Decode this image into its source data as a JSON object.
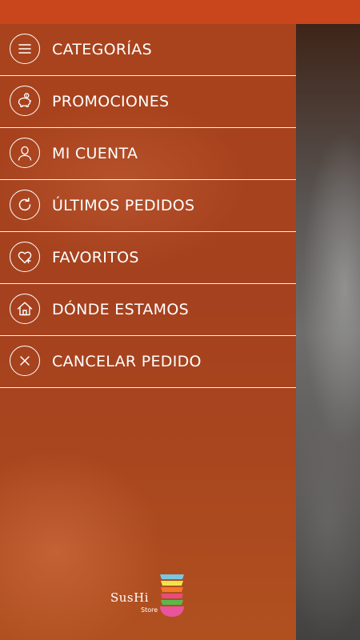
{
  "menu": {
    "items": [
      {
        "label": "CATEGORÍAS",
        "icon": "menu-lines-icon"
      },
      {
        "label": "PROMOCIONES",
        "icon": "piggy-bank-icon"
      },
      {
        "label": "MI CUENTA",
        "icon": "user-icon"
      },
      {
        "label": "ÚLTIMOS PEDIDOS",
        "icon": "refresh-icon"
      },
      {
        "label": "FAVORITOS",
        "icon": "heart-plus-icon"
      },
      {
        "label": "DÓNDE ESTAMOS",
        "icon": "home-icon"
      },
      {
        "label": "CANCELAR PEDIDO",
        "icon": "close-icon"
      }
    ]
  },
  "logo": {
    "brand": "SusHi",
    "sub": "Store",
    "colors": [
      "#e84d7a",
      "#5bb94b",
      "#f07a2a",
      "#7bc7e3",
      "#f2e34a",
      "#e8559a"
    ]
  },
  "colors": {
    "status_bar": "#c9451c",
    "drawer": "#a9431d",
    "text": "#ffffff"
  }
}
